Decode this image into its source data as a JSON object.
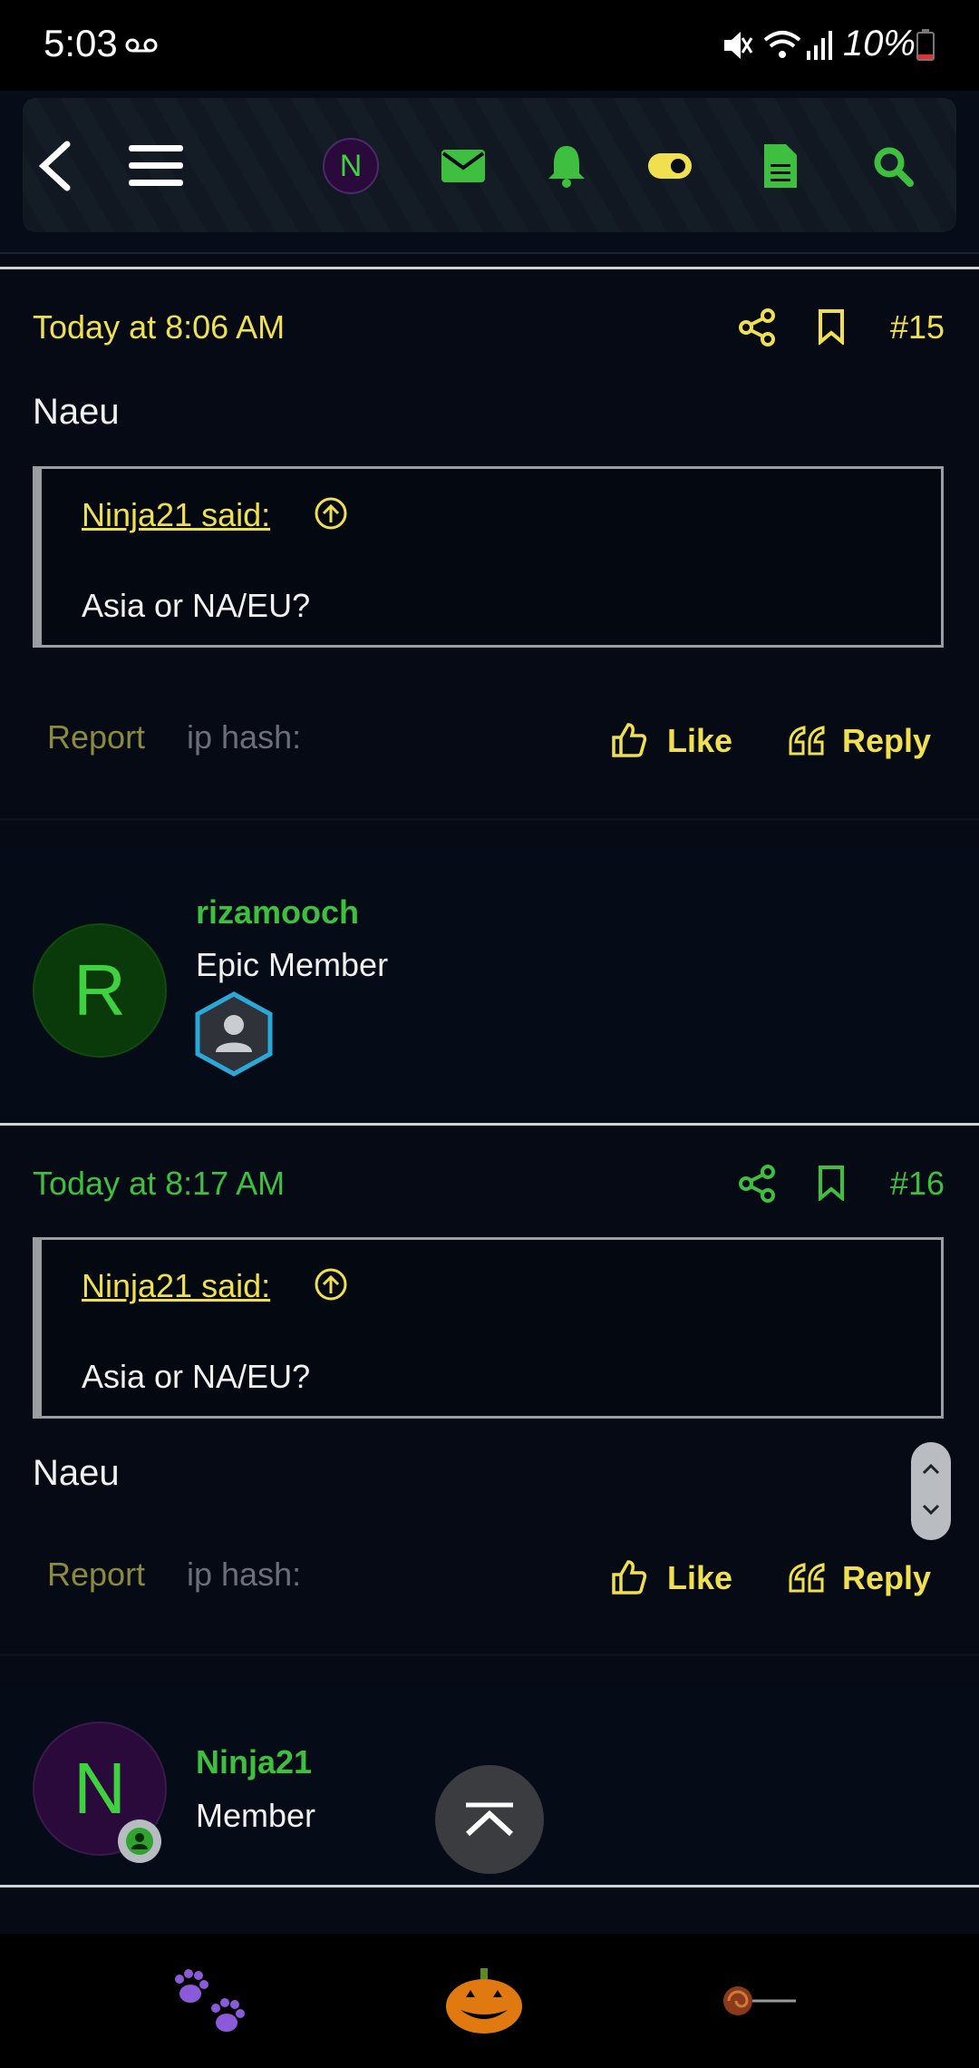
{
  "status_bar": {
    "time": "5:03",
    "battery": "10%"
  },
  "posts": [
    {
      "time": "Today at 8:06 AM",
      "number": "#15",
      "body": "Naeu",
      "quote": {
        "author": "Ninja21 said:",
        "text": "Asia or NA/EU?"
      },
      "report": "Report",
      "ip_hash": "ip hash:",
      "like": "Like",
      "reply": "Reply",
      "meta_color": "#f0e050"
    },
    {
      "time": "Today at 8:17 AM",
      "number": "#16",
      "body": "Naeu",
      "quote": {
        "author": "Ninja21 said:",
        "text": "Asia or NA/EU?"
      },
      "report": "Report",
      "ip_hash": "ip hash:",
      "like": "Like",
      "reply": "Reply",
      "meta_color": "#3fbf3f"
    }
  ],
  "users": [
    {
      "initial": "R",
      "name": "rizamooch",
      "title": "Epic Member"
    },
    {
      "initial": "N",
      "name": "Ninja21",
      "title": "Member"
    }
  ],
  "nav": {
    "avatar_initial": "N"
  },
  "colors": {
    "accent_yellow": "#f0e050",
    "accent_green": "#3fbf3f",
    "background": "#050a14"
  }
}
